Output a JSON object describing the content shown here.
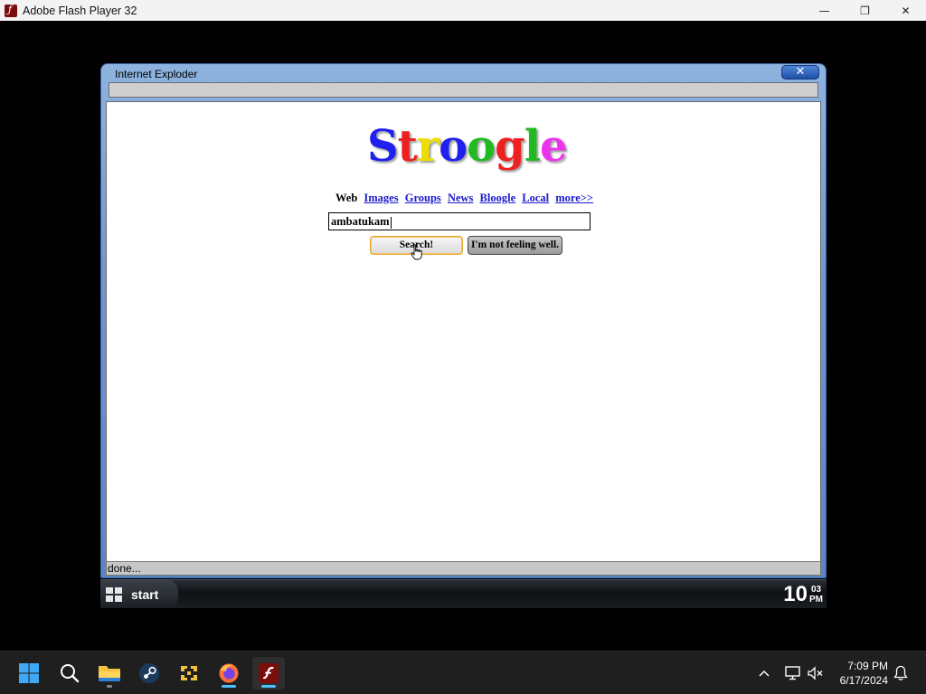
{
  "host": {
    "title": "Adobe Flash Player 32",
    "minimize": "—",
    "maximize": "❐",
    "close": "✕"
  },
  "ie": {
    "title": "Internet Exploder",
    "close_label": "✕",
    "status": "done..."
  },
  "page": {
    "logo": [
      "S",
      "t",
      "r",
      "o",
      "o",
      "g",
      "l",
      "e"
    ],
    "logo_colors": [
      "#2020ee",
      "#ee2020",
      "#eedd00",
      "#2020ee",
      "#20bb20",
      "#ee2020",
      "#20bb20",
      "#ee33ee"
    ],
    "nav": {
      "current": "Web",
      "links": [
        "Images",
        "Groups",
        "News",
        "Bloogle",
        "Local",
        "more>>"
      ]
    },
    "search_value": "ambatukam",
    "search_button": "Search!",
    "lucky_button": "I'm not feeling well."
  },
  "xp_taskbar": {
    "start_label": "start",
    "clock_hour": "10",
    "clock_minutes": "03",
    "clock_ampm": "PM"
  },
  "taskbar": {
    "icons": [
      "windows-start-icon",
      "search-icon",
      "file-explorer-icon",
      "steam-icon",
      "aseprite-icon",
      "firefox-icon",
      "flash-player-icon"
    ],
    "time": "7:09 PM",
    "date": "6/17/2024",
    "tray_chevron": "^"
  }
}
